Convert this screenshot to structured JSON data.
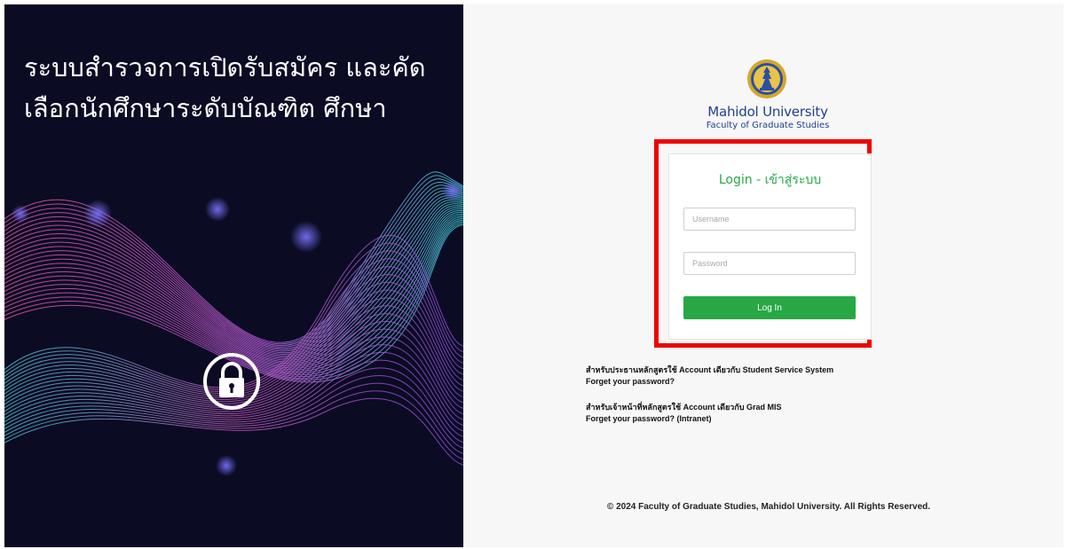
{
  "hero": {
    "title": "ระบบสำรวจการเปิดรับสมัคร และคัดเลือกนักศึกษาระดับบัณฑิต ศึกษา"
  },
  "branding": {
    "university": "Mahidol University",
    "faculty": "Faculty of Graduate Studies"
  },
  "login": {
    "title": "Login - เข้าสู่ระบบ",
    "username_placeholder": "Username",
    "password_placeholder": "Password",
    "button_label": "Log In"
  },
  "help": [
    {
      "note": "สำหรับประธานหลักสูตรใช้ Account เดียวกับ Student Service System",
      "link": "Forget your password?"
    },
    {
      "note": "สำหรับเจ้าหน้าที่หลักสูตรใช้ Account เดียวกับ Grad MIS",
      "link": "Forget your password? (Intranet)"
    }
  ],
  "footer": {
    "copyright": "© 2024 Faculty of Graduate Studies, Mahidol University. All Rights Reserved."
  },
  "colors": {
    "brand_green": "#27a844",
    "brand_blue": "#1f3f8f",
    "highlight_red": "#ee0000",
    "hero_background": "#0b0b24"
  },
  "icons": {
    "hero": "padlock-icon",
    "logo": "university-seal-icon"
  }
}
